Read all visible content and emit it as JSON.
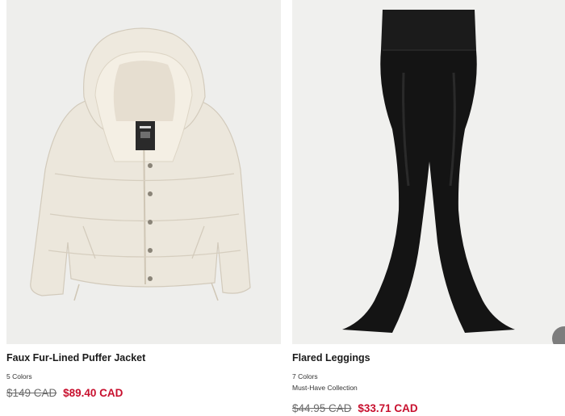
{
  "products": [
    {
      "name": "Faux Fur-Lined Puffer Jacket",
      "colors": "5 Colors",
      "collection": "",
      "original_price": "$149 CAD",
      "sale_price": "$89.40 CAD",
      "image": "cream-puffer-jacket-image"
    },
    {
      "name": "Flared Leggings",
      "colors": "7 Colors",
      "collection": "Must-Have Collection",
      "original_price": "$44.95 CAD",
      "sale_price": "$33.71 CAD",
      "image": "black-flared-leggings-image"
    }
  ],
  "colors": {
    "sale_price": "#c8102e",
    "original_price": "#6b6b6b",
    "image_background": "#eeeeec"
  }
}
